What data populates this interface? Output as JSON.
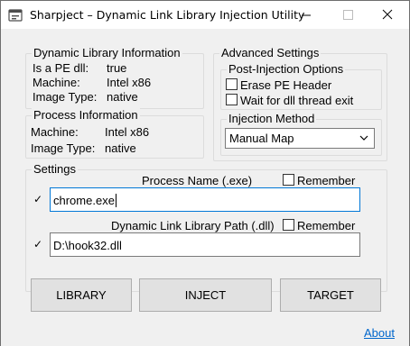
{
  "window": {
    "title": "Sharpject – Dynamic Link Library Injection Utility"
  },
  "library_info": {
    "label": "Dynamic Library Information",
    "pe_label": "Is a PE dll:",
    "pe_value": "true",
    "machine_label": "Machine:",
    "machine_value": "Intel x86",
    "image_type_label": "Image Type:",
    "image_type_value": "native"
  },
  "process_info": {
    "label": "Process Information",
    "machine_label": "Machine:",
    "machine_value": "Intel x86",
    "image_type_label": "Image Type:",
    "image_type_value": "native"
  },
  "advanced": {
    "label": "Advanced Settings",
    "post_injection": {
      "label": "Post-Injection Options",
      "erase_pe_header": {
        "label": "Erase PE Header",
        "checked": false
      },
      "wait_for_thread": {
        "label": "Wait for dll thread exit",
        "checked": false
      }
    },
    "injection_method": {
      "label": "Injection Method",
      "selected": "Manual Map"
    }
  },
  "settings": {
    "label": "Settings",
    "process_name": {
      "label": "Process Name (.exe)",
      "value": "chrome.exe",
      "remember_label": "Remember",
      "remember_checked": false,
      "valid_mark": "✓"
    },
    "dll_path": {
      "label": "Dynamic Link Library Path (.dll)",
      "value": "D:\\hook32.dll",
      "remember_label": "Remember",
      "remember_checked": false,
      "valid_mark": "✓"
    }
  },
  "actions": {
    "library_label": "LIBRARY",
    "inject_label": "INJECT",
    "target_label": "TARGET"
  },
  "footer": {
    "about_label": "About"
  },
  "colors": {
    "accent": "#0078d7",
    "link": "#0066cc",
    "window_bg": "#f0f0f0",
    "button_bg": "#e1e1e1"
  }
}
